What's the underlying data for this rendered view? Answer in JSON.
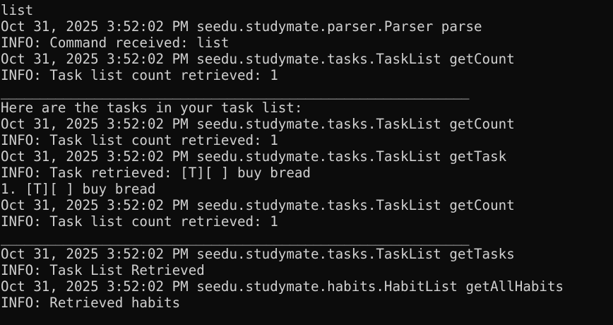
{
  "terminal": {
    "lines": [
      "list",
      "Oct 31, 2025 3:52:02 PM seedu.studymate.parser.Parser parse",
      "INFO: Command received: list",
      "Oct 31, 2025 3:52:02 PM seedu.studymate.tasks.TaskList getCount",
      "INFO: Task list count retrieved: 1",
      "____________________________________________________________",
      "Here are the tasks in your task list:",
      "Oct 31, 2025 3:52:02 PM seedu.studymate.tasks.TaskList getCount",
      "INFO: Task list count retrieved: 1",
      "Oct 31, 2025 3:52:02 PM seedu.studymate.tasks.TaskList getTask",
      "INFO: Task retrieved: [T][ ] buy bread",
      "1. [T][ ] buy bread",
      "Oct 31, 2025 3:52:02 PM seedu.studymate.tasks.TaskList getCount",
      "INFO: Task list count retrieved: 1",
      "____________________________________________________________",
      "Oct 31, 2025 3:52:02 PM seedu.studymate.tasks.TaskList getTasks",
      "INFO: Task List Retrieved",
      "Oct 31, 2025 3:52:02 PM seedu.studymate.habits.HabitList getAllHabits",
      "INFO: Retrieved habits"
    ]
  },
  "colors": {
    "background": "#0c0c0c",
    "text": "#d0d0d0"
  }
}
